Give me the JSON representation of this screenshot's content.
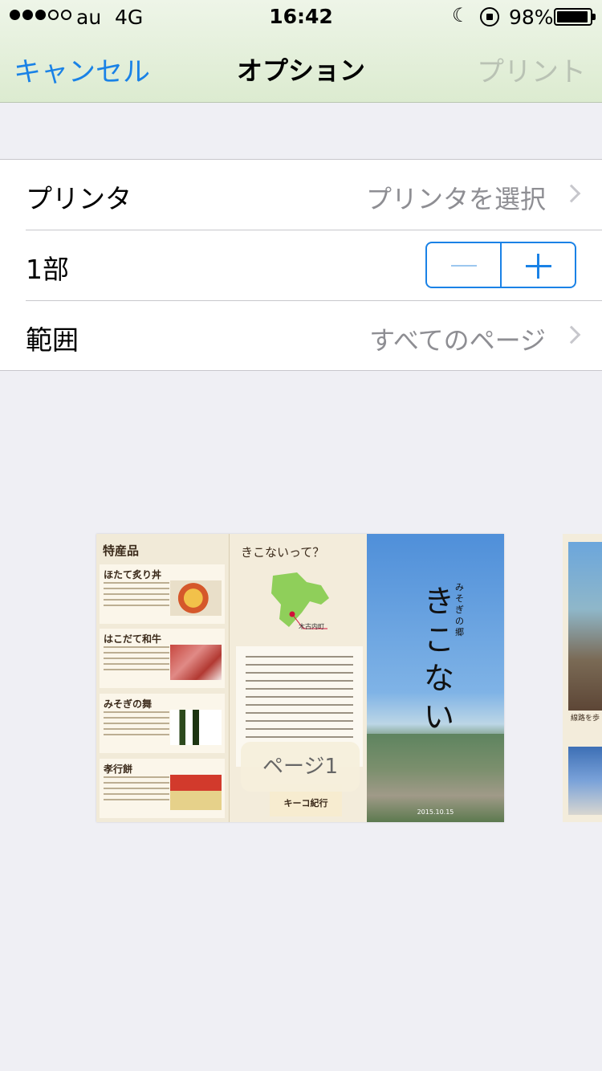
{
  "status_bar": {
    "carrier": "au",
    "network": "4G",
    "time": "16:42",
    "battery_percent": "98%",
    "signal_bars_filled": 3,
    "signal_bars_total": 5
  },
  "nav": {
    "cancel_label": "キャンセル",
    "title": "オプション",
    "print_label": "プリント"
  },
  "options": {
    "printer": {
      "label": "プリンタ",
      "value": "プリンタを選択"
    },
    "copies": {
      "label": "1部"
    },
    "range": {
      "label": "範囲",
      "value": "すべてのページ"
    }
  },
  "preview": {
    "page_label": "ページ1",
    "panel1": {
      "title": "特産品",
      "items": [
        "ほたて炙り丼",
        "はこだて和牛",
        "みそぎの舞",
        "孝行餅"
      ]
    },
    "panel2": {
      "title": "きこないって？",
      "map_label": "木古内町",
      "footer": "キーコ紀行"
    },
    "panel3": {
      "subtitle": "みそぎの郷",
      "title": "きこない",
      "date": "2015.10.15"
    },
    "next_page_caption": "線路を歩"
  },
  "colors": {
    "accent": "#1a82e6",
    "disabled": "#b9c2b4",
    "background": "#efeff4"
  }
}
